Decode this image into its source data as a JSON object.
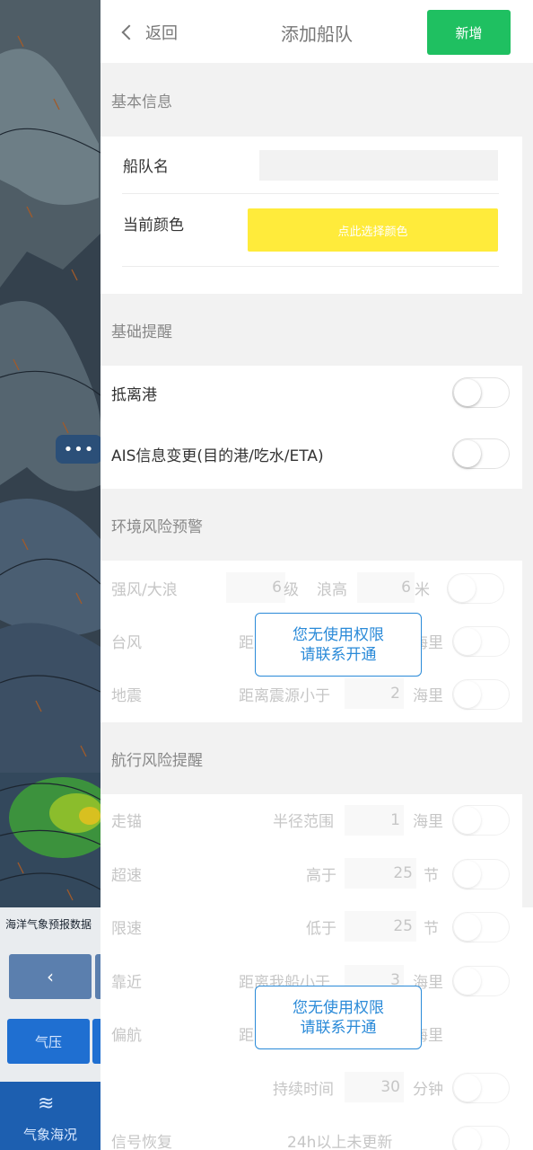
{
  "map": {
    "caption": "海洋气象预报数据",
    "back_arrow": "‹",
    "layer_button": "气压",
    "bottom_nav_label": "气象海况",
    "more_dots": "•••"
  },
  "header": {
    "back_label": "返回",
    "title": "添加船队",
    "add_button": "新增"
  },
  "basic_info": {
    "title": "基本信息",
    "fleet_name_label": "船队名",
    "fleet_name_value": "",
    "color_label": "当前颜色",
    "color_button": "点此选择颜色",
    "color_value": "#ffeb3b"
  },
  "basic_alerts": {
    "title": "基础提醒",
    "items": [
      {
        "label": "抵离港",
        "enabled": false
      },
      {
        "label": "AIS信息变更(目的港/吃水/ETA)",
        "enabled": false
      }
    ]
  },
  "env_risk": {
    "title": "环境风险预警",
    "wind": {
      "label": "强风/大浪",
      "wind_value": "6",
      "wind_unit": "级",
      "wave_label": "浪高",
      "wave_value": "6",
      "wave_unit": "米"
    },
    "typhoon": {
      "label": "台风",
      "cond_prefix": "距",
      "unit": "海里"
    },
    "earthquake": {
      "label": "地震",
      "cond": "距离震源小于",
      "value": "2",
      "unit": "海里"
    },
    "permission": {
      "line1": "您无使用权限",
      "line2": "请联系开通"
    }
  },
  "nav_risk": {
    "title": "航行风险提醒",
    "anchor": {
      "label": "走锚",
      "cond": "半径范围",
      "value": "1",
      "unit": "海里"
    },
    "overspeed": {
      "label": "超速",
      "cond": "高于",
      "value": "25",
      "unit": "节"
    },
    "underspeed": {
      "label": "限速",
      "cond": "低于",
      "value": "25",
      "unit": "节"
    },
    "approach": {
      "label": "靠近",
      "cond": "距离我船小于",
      "value": "3",
      "unit": "海里"
    },
    "deviation": {
      "label": "偏航",
      "cond_prefix": "距",
      "unit": "海里"
    },
    "duration": {
      "cond": "持续时间",
      "value": "30",
      "unit": "分钟"
    },
    "signal": {
      "label": "信号恢复",
      "cond": "24h以上未更新"
    },
    "permission": {
      "line1": "您无使用权限",
      "line2": "请联系开通"
    }
  }
}
